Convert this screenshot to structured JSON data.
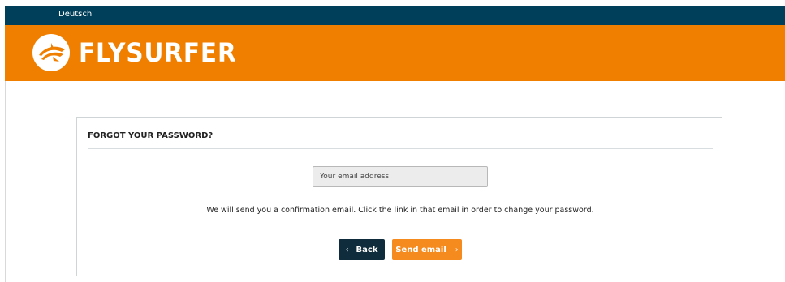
{
  "topbar": {
    "language_link": "Deutsch"
  },
  "header": {
    "brand_name": "FLYSURFER",
    "logo_icon": "flysurfer-wing-logo-icon",
    "color": "#f07f00"
  },
  "forgot_password": {
    "title": "FORGOT YOUR PASSWORD?",
    "email_input": {
      "placeholder": "Your email address",
      "value": ""
    },
    "info_text": "We will send you a confirmation email. Click the link in that email in order to change your password.",
    "back_button": {
      "label": "Back",
      "icon": "chevron-left-icon",
      "color": "#0f2c3c"
    },
    "send_button": {
      "label": "Send email",
      "icon": "chevron-right-icon",
      "color": "#f58a1f"
    }
  }
}
